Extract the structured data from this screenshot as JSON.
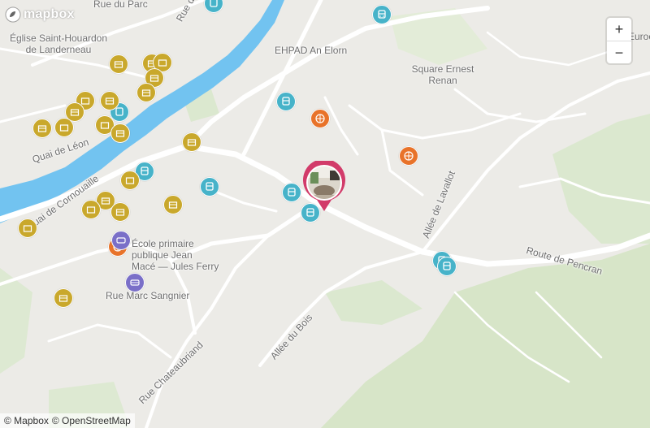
{
  "map": {
    "provider": "mapbox",
    "colors": {
      "land": "#ecebe7",
      "water": "#72c3f0",
      "park": "#d9e7cc",
      "road": "#ffffff",
      "transit_poi": "#47b3c9",
      "sport_poi": "#e8732a",
      "shop_poi": "#c9a82c",
      "school_poi": "#7a6fc8",
      "marker_ring": "#d23b6a"
    },
    "labels": {
      "rue_du_parc": "Rue du Parc",
      "rue_de_la": "Rue de la",
      "eglise": "Église Saint-Houardon\nde Landerneau",
      "ehpad": "EHPAD An Elorn",
      "square": "Square Ernest\nRenan",
      "quai_leon": "Quai de Léon",
      "quai_cornouaille": "Quai de Cornouaille",
      "ecole": "École primaire\npublique Jean\nMacé — Jules Ferry",
      "rue_marc": "Rue Marc Sangnier",
      "allee_lavallot": "Allée de Lavallot",
      "route_pencran": "Route de Pencran",
      "allee_bois": "Allée du Bois",
      "rue_chateaubriand": "Rue Chateaubriand",
      "edge": "Euroc"
    },
    "zoom": {
      "in": "+",
      "out": "−"
    },
    "attribution": {
      "mapbox": "© Mapbox",
      "osm": "© OpenStreetMap"
    },
    "icons": {
      "transit": "bus-icon",
      "sport": "basketball-icon",
      "shop": "shop-icon",
      "school": "school-bus-icon"
    }
  }
}
